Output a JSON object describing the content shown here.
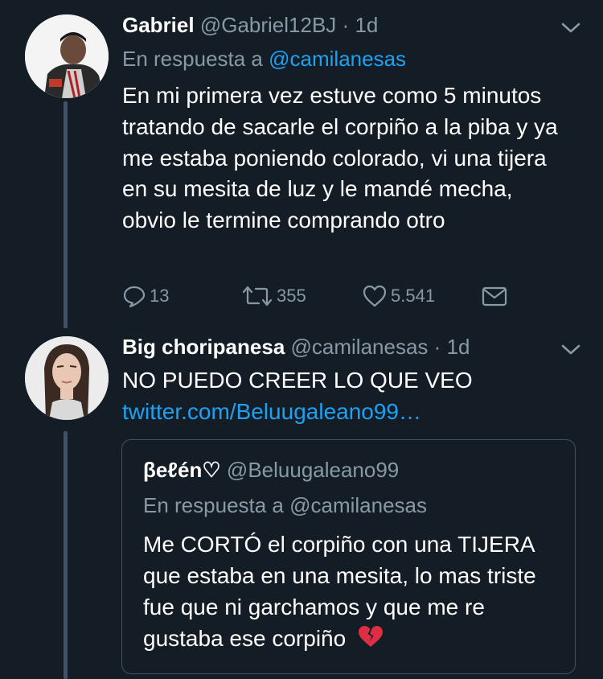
{
  "tweets": [
    {
      "name": "Gabriel",
      "handle": "@Gabriel12BJ",
      "dot": "·",
      "time": "1d",
      "reply_prefix": "En respuesta a",
      "reply_mention": "@camilanesas",
      "text": "En mi primera vez estuve como 5 minutos tratando de sacarle el corpiño a la piba y ya me estaba poniendo colorado, vi una tijera en su mesita de luz y le mandé mecha, obvio le termine comprando otro",
      "replies": "13",
      "retweets": "355",
      "likes": "5.541"
    },
    {
      "name": "Big choripanesa",
      "handle": "@camilanesas",
      "dot": "·",
      "time": "1d",
      "text": "NO PUEDO CREER LO QUE VEO",
      "link": "twitter.com/Beluugaleano99…",
      "quote": {
        "name": "βeℓén♡",
        "handle": "@Beluugaleano99",
        "reply_line": "En respuesta a @camilanesas",
        "text": "Me CORTÓ el corpiño con una TIJERA que estaba en una mesita, lo mas triste fue que ni garchamos y que me re gustaba ese corpiño",
        "emoji": "💔"
      }
    }
  ],
  "colors": {
    "background": "#141d26",
    "secondary_text": "#8899a6",
    "link": "#1da1f2",
    "thread_line": "#3d5466"
  },
  "icons": [
    "reply-icon",
    "retweet-icon",
    "like-icon",
    "dm-icon",
    "chevron-down-icon",
    "broken-heart-emoji"
  ]
}
